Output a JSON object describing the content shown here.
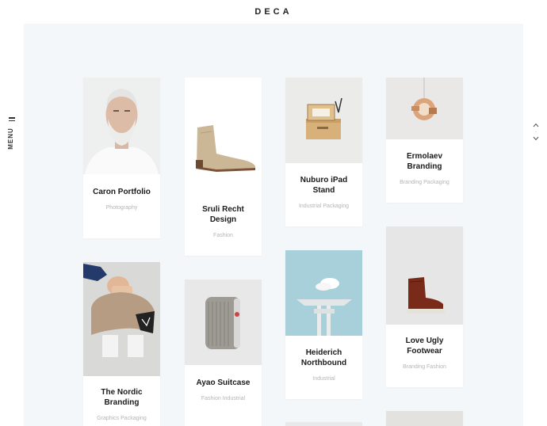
{
  "header": {
    "logo": "DECA"
  },
  "side_menu": {
    "label": "MENU",
    "icon": "hamburger-icon"
  },
  "scroll_nav": {
    "up_icon": "chevron-up-icon",
    "down_icon": "chevron-down-icon",
    "dot": "·"
  },
  "portfolio": {
    "items": [
      {
        "title": "Caron Portfolio",
        "tags": "Photography",
        "image": "man-portrait"
      },
      {
        "title": "Sruli Recht Design",
        "tags": "Fashion",
        "image": "boot"
      },
      {
        "title": "Nuburo iPad Stand",
        "tags": "Industrial Packaging",
        "image": "ipad-stand"
      },
      {
        "title": "Ermolaev Branding",
        "tags": "Branding Packaging",
        "image": "hanging-lamp"
      },
      {
        "title": "The Nordic Branding",
        "tags": "Graphics Packaging",
        "image": "cup-carrier"
      },
      {
        "title": "Ayao Suitcase",
        "tags": "Fashion Industrial",
        "image": "suitcase"
      },
      {
        "title": "Heiderich Northbound",
        "tags": "Industrial",
        "image": "water-tower"
      },
      {
        "title": "Love Ugly Footwear",
        "tags": "Branding Fashion",
        "image": "brown-boot"
      }
    ]
  }
}
